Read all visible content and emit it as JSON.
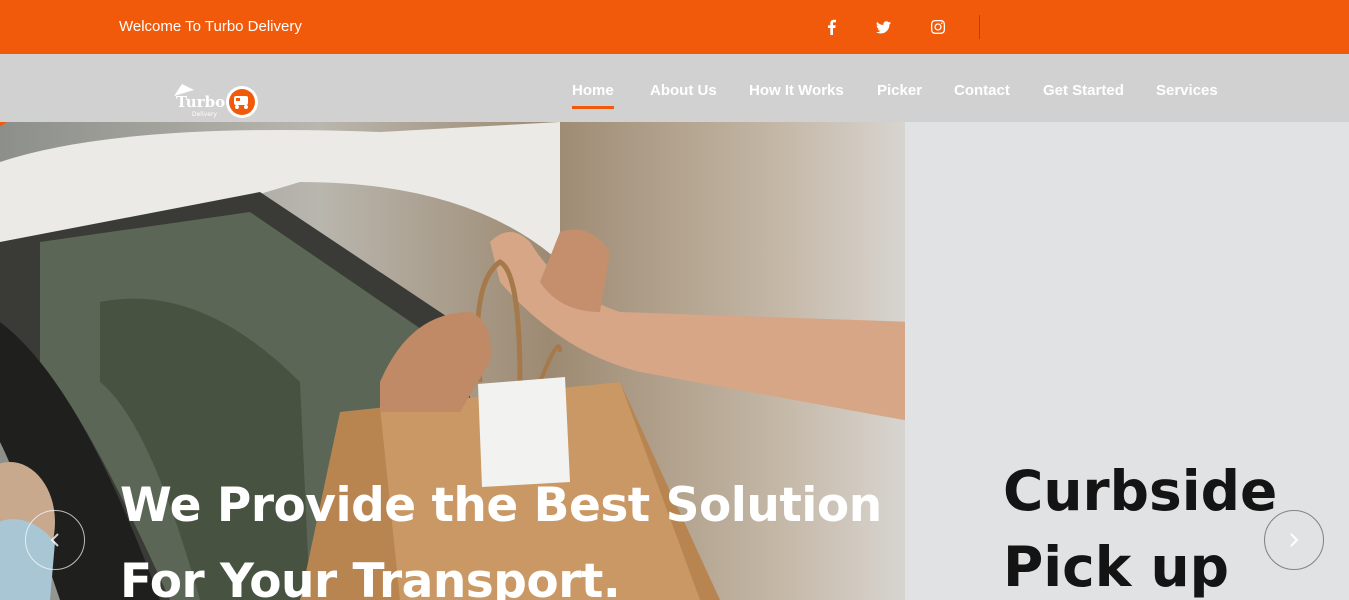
{
  "topbar": {
    "welcome": "Welcome To Turbo Delivery",
    "social": [
      "facebook-icon",
      "twitter-icon",
      "instagram-icon"
    ]
  },
  "brand": {
    "name": "Turbo",
    "tagline": "Delivery",
    "accent": "#f05a0a"
  },
  "nav": {
    "items": [
      {
        "label": "Home",
        "active": true
      },
      {
        "label": "About Us"
      },
      {
        "label": "How It Works"
      },
      {
        "label": "Picker"
      },
      {
        "label": "Contact"
      },
      {
        "label": "Get Started"
      },
      {
        "label": "Services"
      }
    ]
  },
  "hero": {
    "title_line1": "We Provide the Best Solution",
    "title_line2": "For Your Transport.",
    "sign_line1": "Curbside",
    "sign_line2": "Pick up",
    "prev_icon": "chevron-left-icon",
    "next_icon": "chevron-right-icon"
  }
}
